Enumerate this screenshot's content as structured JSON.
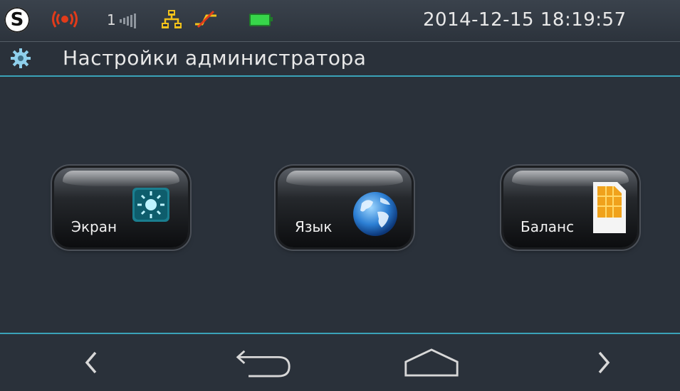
{
  "status_bar": {
    "logo_letter": "S",
    "sim_slot": "1",
    "datetime": "2014-12-15 18:19:57",
    "icons": [
      "app-logo-icon",
      "alarm-icon",
      "signal-icon",
      "network-icon",
      "no-link-icon",
      "battery-icon"
    ]
  },
  "header": {
    "title": "Настройки администратора",
    "icon": "gear-icon"
  },
  "tiles": [
    {
      "label": "Экран",
      "icon": "brightness-icon"
    },
    {
      "label": "Язык",
      "icon": "globe-icon"
    },
    {
      "label": "Баланс",
      "icon": "sim-card-icon"
    }
  ],
  "nav": {
    "items": [
      "prev-arrow-icon",
      "back-icon",
      "home-icon",
      "next-arrow-icon"
    ]
  },
  "colors": {
    "background": "#2a313a",
    "accent_line": "#3aa2b8",
    "alarm": "#e23b1a",
    "battery": "#37d64a",
    "network": "#f2c21b"
  }
}
